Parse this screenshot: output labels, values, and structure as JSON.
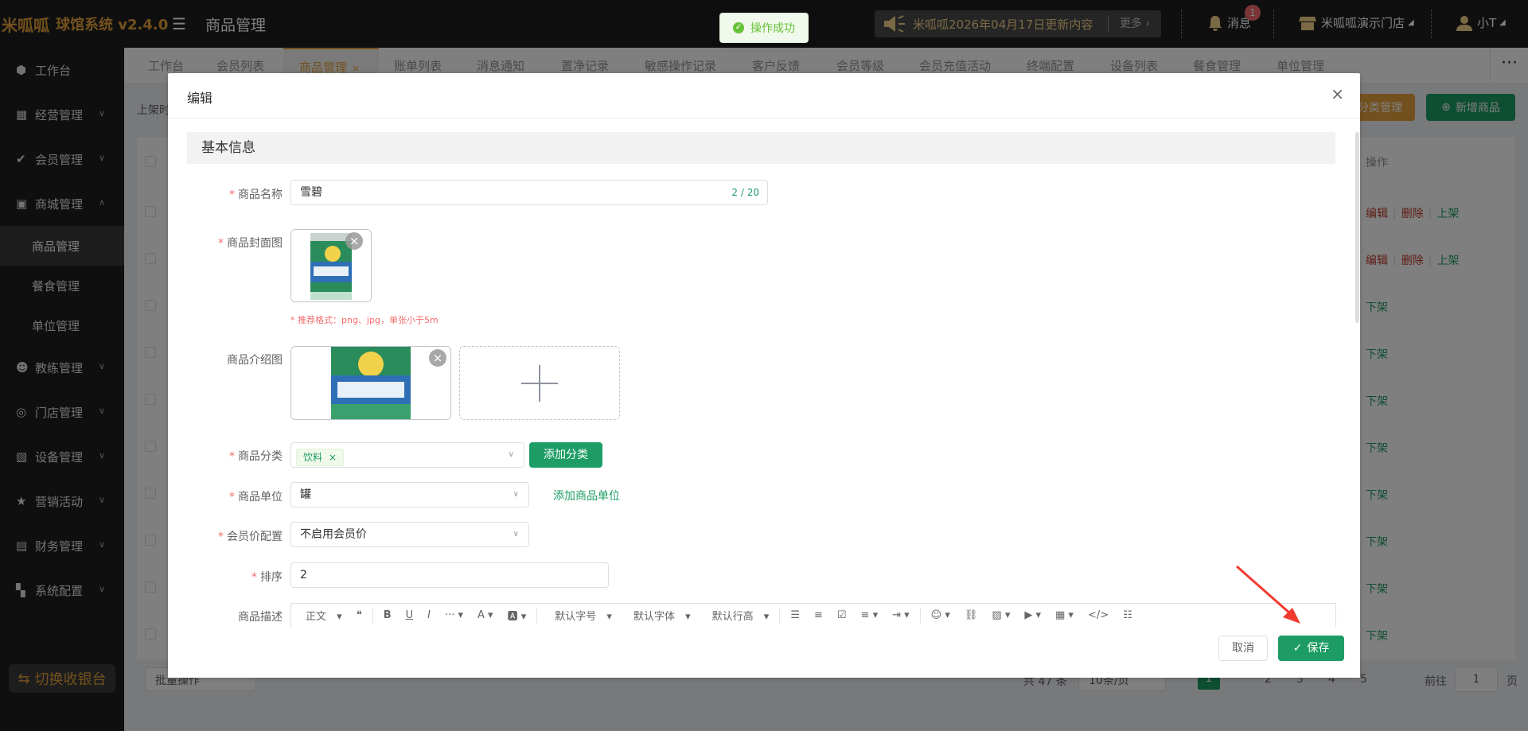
{
  "header": {
    "logo_text": "米呱呱",
    "app_title": "球馆系统 v2.4.0",
    "page_title": "商品管理",
    "toast": "操作成功",
    "notice_text": "米呱呱2026年04月17日更新内容",
    "notice_more": "更多",
    "messages_label": "消息",
    "messages_badge": "1",
    "store_name": "米呱呱演示门店",
    "user_name": "小T"
  },
  "sidebar": {
    "items": [
      {
        "label": "工作台"
      },
      {
        "label": "经营管理"
      },
      {
        "label": "会员管理"
      },
      {
        "label": "商城管理"
      },
      {
        "label": "教练管理"
      },
      {
        "label": "门店管理"
      },
      {
        "label": "设备管理"
      },
      {
        "label": "营销活动"
      },
      {
        "label": "财务管理"
      },
      {
        "label": "系统配置"
      }
    ],
    "sub_items": [
      {
        "label": "商品管理"
      },
      {
        "label": "餐食管理"
      },
      {
        "label": "单位管理"
      }
    ],
    "switch_button": "切换收银台"
  },
  "tabs": [
    {
      "label": "工作台"
    },
    {
      "label": "会员列表"
    },
    {
      "label": "商品管理"
    },
    {
      "label": "账单列表"
    },
    {
      "label": "消息通知"
    },
    {
      "label": "置净记录"
    },
    {
      "label": "敏感操作记录"
    },
    {
      "label": "客户反馈"
    },
    {
      "label": "会员等级"
    },
    {
      "label": "会员充值活动"
    },
    {
      "label": "终端配置"
    },
    {
      "label": "设备列表"
    },
    {
      "label": "餐食管理"
    },
    {
      "label": "单位管理"
    }
  ],
  "list": {
    "filter_label": "上架时",
    "category_button": "分类管理",
    "add_button": "新增商品",
    "op_header": "操作",
    "row_ops": [
      {
        "edit": "编辑",
        "del": "删除",
        "toggle": "上架"
      },
      {
        "edit": "编辑",
        "del": "删除",
        "toggle": "上架"
      },
      {
        "toggle": "下架"
      },
      {
        "toggle": "下架"
      },
      {
        "toggle": "下架"
      },
      {
        "toggle": "下架"
      },
      {
        "toggle": "下架"
      },
      {
        "toggle": "下架"
      },
      {
        "toggle": "下架"
      },
      {
        "toggle": "下架"
      }
    ],
    "batch": "批量操作",
    "total": "共 47 条",
    "page_size": "10条/页",
    "pages": [
      "1",
      "2",
      "3",
      "4",
      "5"
    ],
    "goto_label": "前往",
    "goto_value": "1",
    "page_unit": "页"
  },
  "dialog": {
    "title": "编辑",
    "section": "基本信息",
    "fields": {
      "name_label": "商品名称",
      "name_value": "雪碧",
      "name_count": "2 / 20",
      "cover_label": "商品封面图",
      "cover_hint": "* 推荐格式：png、jpg，单张小于5m",
      "intro_label": "商品介绍图",
      "category_label": "商品分类",
      "category_tag": "饮料",
      "add_category": "添加分类",
      "unit_label": "商品单位",
      "unit_value": "罐",
      "add_unit": "添加商品单位",
      "member_price_label": "会员价配置",
      "member_price_value": "不启用会员价",
      "sort_label": "排序",
      "sort_value": "2",
      "desc_label": "商品描述"
    },
    "editor_toolbar": [
      "正文",
      "默认字号",
      "默认字体",
      "默认行高"
    ],
    "cancel": "取消",
    "save": "保存"
  }
}
